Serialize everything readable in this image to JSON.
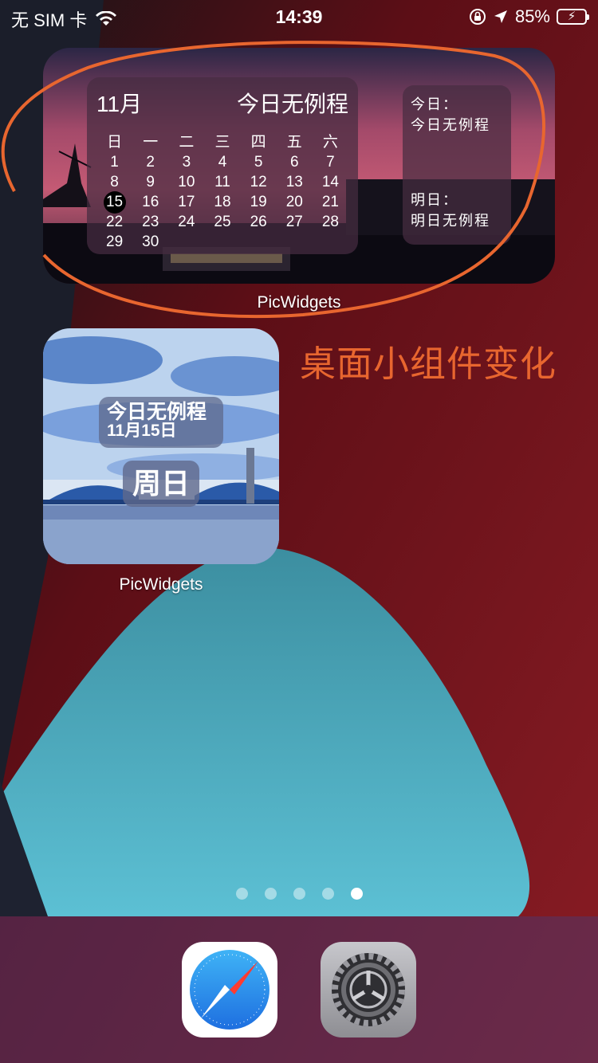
{
  "status_bar": {
    "carrier": "无 SIM 卡",
    "time": "14:39",
    "battery": "85%",
    "battery_level": 0.85
  },
  "calendar_widget": {
    "month": "11月",
    "status": "今日无例程",
    "weekdays": [
      "日",
      "一",
      "二",
      "三",
      "四",
      "五",
      "六"
    ],
    "days": [
      "1",
      "2",
      "3",
      "4",
      "5",
      "6",
      "7",
      "8",
      "9",
      "10",
      "11",
      "12",
      "13",
      "14",
      "15",
      "16",
      "17",
      "18",
      "19",
      "20",
      "21",
      "22",
      "23",
      "24",
      "25",
      "26",
      "27",
      "28",
      "29",
      "30"
    ],
    "today": "15",
    "schedule": {
      "today_label": "今日：",
      "today_text": "今日无例程",
      "tomorrow_label": "明日：",
      "tomorrow_text": "明日无例程"
    },
    "app_label": "PicWidgets"
  },
  "annotation": "桌面小组件变化",
  "small_widget": {
    "line1": "今日无例程",
    "line2": "11月15日",
    "weekday": "周日",
    "app_label": "PicWidgets"
  },
  "page_dots": {
    "count": 5,
    "active_index": 4
  },
  "dock": {
    "apps": [
      {
        "name": "safari-icon"
      },
      {
        "name": "settings-icon"
      }
    ]
  },
  "colors": {
    "annotation": "#e8662f",
    "battery_fill": "#4cd964"
  }
}
